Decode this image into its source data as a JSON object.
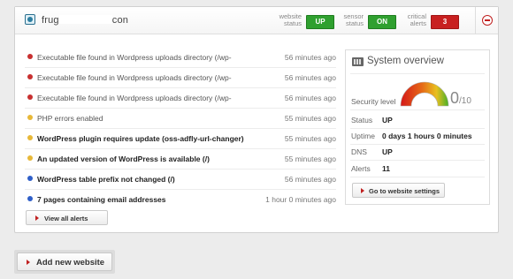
{
  "site": {
    "name_prefix": "frug",
    "name_suffix": "con"
  },
  "status": {
    "website_label": "website status",
    "website_value": "UP",
    "sensor_label": "sensor status",
    "sensor_value": "ON",
    "critical_label": "critical alerts",
    "critical_value": "3"
  },
  "alerts": [
    {
      "severity": "red",
      "text": "Executable file found in Wordpress uploads directory (/wp-",
      "time": "56 minutes ago",
      "bold": false
    },
    {
      "severity": "red",
      "text": "Executable file found in Wordpress uploads directory (/wp-",
      "time": "56 minutes ago",
      "bold": false
    },
    {
      "severity": "red",
      "text": "Executable file found in Wordpress uploads directory (/wp-",
      "time": "56 minutes ago",
      "bold": false
    },
    {
      "severity": "yellow",
      "text": "PHP errors enabled",
      "time": "55 minutes ago",
      "bold": false
    },
    {
      "severity": "yellow",
      "text": "WordPress plugin requires update (oss-adfly-url-changer)",
      "time": "55 minutes ago",
      "bold": true
    },
    {
      "severity": "yellow",
      "text": "An updated version of WordPress is available (/)",
      "time": "55 minutes ago",
      "bold": true
    },
    {
      "severity": "blue",
      "text": "WordPress table prefix not changed (/)",
      "time": "56 minutes ago",
      "bold": true
    },
    {
      "severity": "blue",
      "text": "7 pages containing email addresses",
      "time": "1 hour 0 minutes ago",
      "bold": true
    }
  ],
  "view_all_label": "View all alerts",
  "overview": {
    "title": "System overview",
    "security_label": "Security level",
    "security_score": "0",
    "security_max": "/10",
    "rows": [
      {
        "label": "Status",
        "value": "UP"
      },
      {
        "label": "Uptime",
        "value": "0 days 1 hours 0 minutes"
      },
      {
        "label": "DNS",
        "value": "UP"
      },
      {
        "label": "Alerts",
        "value": "11"
      }
    ],
    "settings_button": "Go to website settings"
  },
  "add_website_label": "Add new website",
  "colors": {
    "ok_green": "#2fa02f",
    "critical_red": "#c82020",
    "sev_red": "#c83030",
    "sev_yellow": "#e8b838",
    "sev_blue": "#2f5fc8"
  },
  "icons": {
    "site": "website-icon",
    "overview": "server-icon",
    "collapse": "minus-circle-icon",
    "arrow": "triangle-right-icon"
  }
}
